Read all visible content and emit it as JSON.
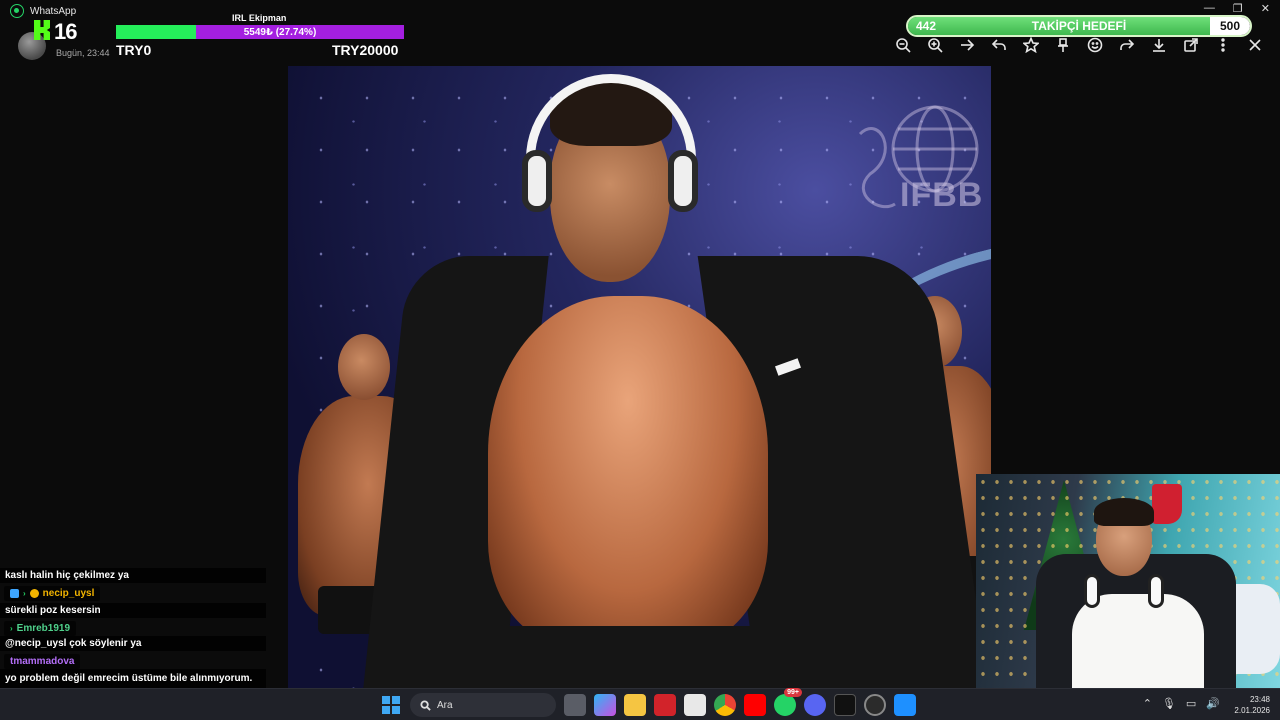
{
  "window": {
    "app_title": "WhatsApp",
    "controls": [
      "—",
      "❐",
      "✕"
    ]
  },
  "chat_header": {
    "message_time": "Bugün, 23:44"
  },
  "kick": {
    "viewer_count": "16"
  },
  "donation_goal": {
    "title": "IRL Ekipman",
    "progress_text": "5549₺ (27.74%)",
    "progress_fraction": 0.2774,
    "min_label": "TRY0",
    "max_label": "TRY20000",
    "fill_color": "#25ef5a",
    "track_color": "#a41fe0"
  },
  "follower_goal": {
    "current": "442",
    "label": "TAKİPÇİ HEDEFİ",
    "target": "500",
    "progress_fraction": 0.884
  },
  "viewer_toolbar": [
    {
      "name": "zoom-out-icon"
    },
    {
      "name": "zoom-in-icon"
    },
    {
      "name": "next-arrow-icon"
    },
    {
      "name": "reply-icon"
    },
    {
      "name": "star-icon"
    },
    {
      "name": "pin-icon"
    },
    {
      "name": "emoji-icon"
    },
    {
      "name": "forward-icon"
    },
    {
      "name": "download-icon"
    },
    {
      "name": "open-external-icon"
    },
    {
      "name": "more-options-icon"
    },
    {
      "name": "close-icon"
    }
  ],
  "photo": {
    "logo_text": "IFBB"
  },
  "chat": {
    "messages": [
      {
        "user": "",
        "text": "kaslı halin hiç çekilmez ya"
      },
      {
        "user": "necip_uysl",
        "user_color": "#f2b400",
        "text": "sürekli poz kesersin"
      },
      {
        "user": "Emreb1919",
        "user_color": "#4fd18b",
        "text": "@necip_uysl çok söylenir ya"
      },
      {
        "user": "tmammadova",
        "user_color": "#b36ef7",
        "text": "yo problem değil emrecim üstüme bile alınmıyorum. benim eşim değil zaten"
      }
    ]
  },
  "taskbar": {
    "search_placeholder": "Ara",
    "whatsapp_badge": "99+",
    "time": "23:48",
    "date": "2.01.2026"
  }
}
